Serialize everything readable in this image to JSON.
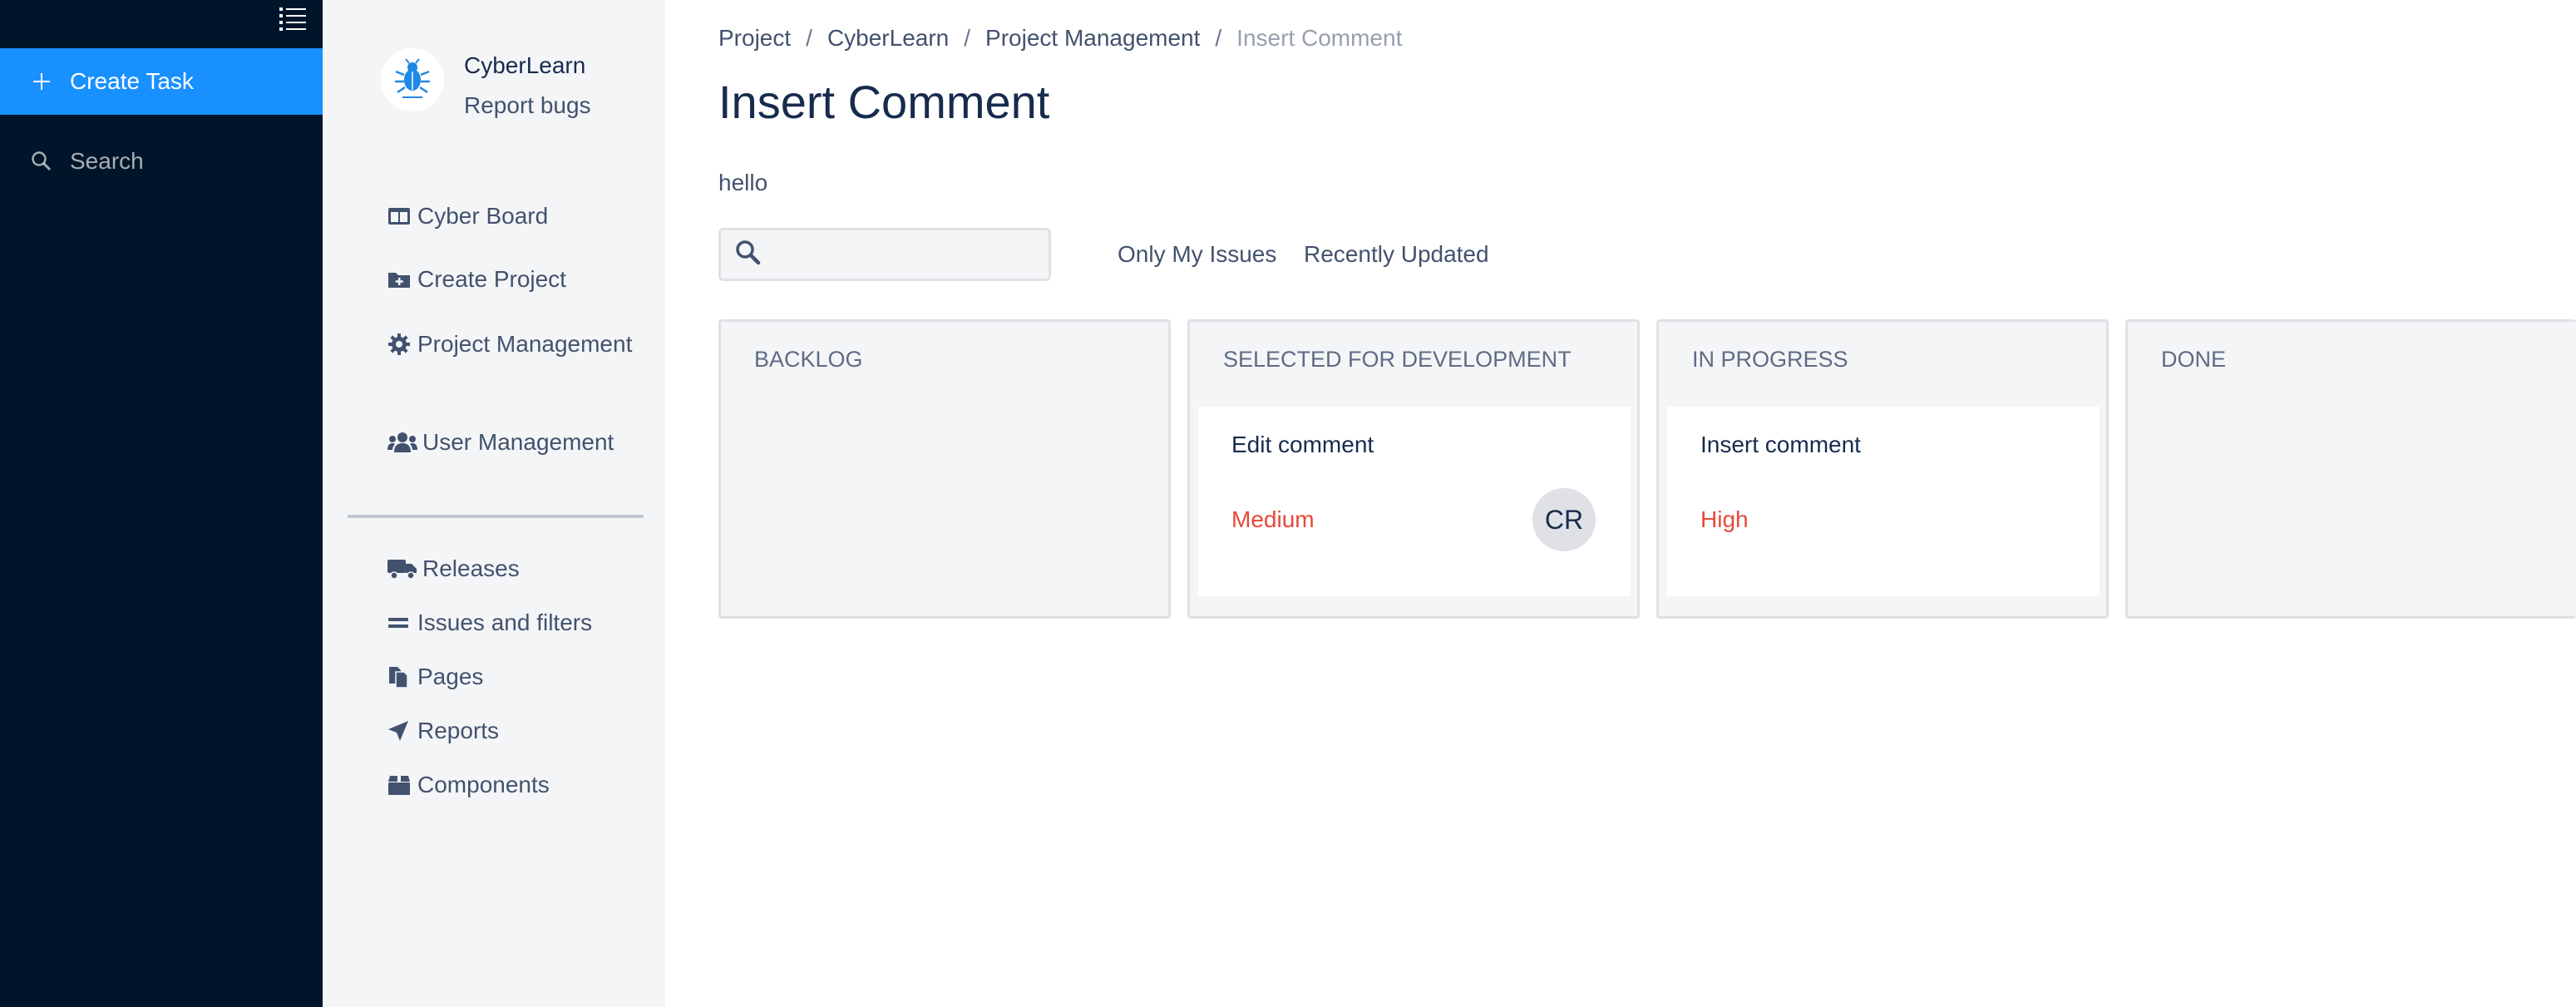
{
  "rail": {
    "create_task_label": "Create Task",
    "search_label": "Search"
  },
  "brand": {
    "name": "CyberLearn",
    "subtitle": "Report bugs"
  },
  "menu": {
    "items": [
      {
        "label": "Cyber Board",
        "icon": "board-icon"
      },
      {
        "label": "Create Project",
        "icon": "folder-plus-icon"
      },
      {
        "label": "Project Management",
        "icon": "gear-icon"
      },
      {
        "label": "User Management",
        "icon": "users-icon"
      }
    ],
    "items2": [
      {
        "label": "Releases",
        "icon": "truck-icon"
      },
      {
        "label": "Issues and filters",
        "icon": "equals-icon"
      },
      {
        "label": "Pages",
        "icon": "copy-icon"
      },
      {
        "label": "Reports",
        "icon": "paper-plane-icon"
      },
      {
        "label": "Components",
        "icon": "box-icon"
      }
    ]
  },
  "breadcrumb": [
    "Project",
    "CyberLearn",
    "Project Management",
    "Insert Comment"
  ],
  "page": {
    "title": "Insert Comment",
    "description": "hello"
  },
  "search": {
    "value": "",
    "placeholder": ""
  },
  "filters": {
    "only_my_issues": "Only My Issues",
    "recently_updated": "Recently Updated"
  },
  "board": {
    "columns": [
      {
        "title": "BACKLOG",
        "cards": []
      },
      {
        "title": "SELECTED FOR DEVELOPMENT",
        "cards": [
          {
            "title": "Edit comment",
            "priority": "Medium",
            "assignee": "CR"
          }
        ]
      },
      {
        "title": "IN PROGRESS",
        "cards": [
          {
            "title": "Insert comment",
            "priority": "High"
          }
        ]
      },
      {
        "title": "DONE",
        "cards": []
      }
    ]
  },
  "colors": {
    "rail_bg": "#001529",
    "accent": "#1890ff",
    "priority": "#e5493a",
    "menu_bg": "#f4f5f7"
  }
}
